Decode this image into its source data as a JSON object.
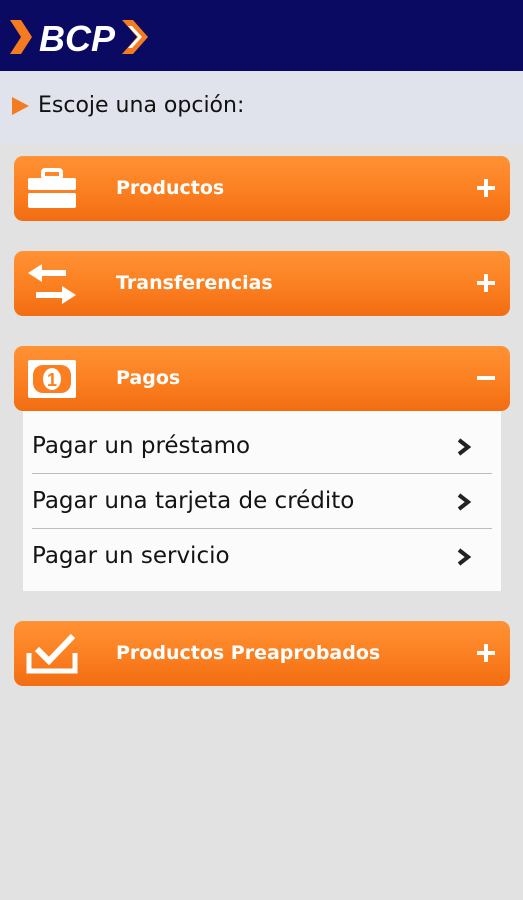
{
  "header": {
    "logo_text": "BCP"
  },
  "prompt": {
    "text": "Escoje una opción:"
  },
  "sections": [
    {
      "label": "Productos",
      "toggle": "plus",
      "icon": "briefcase-icon"
    },
    {
      "label": "Transferencias",
      "toggle": "plus",
      "icon": "transfer-arrows-icon"
    },
    {
      "label": "Pagos",
      "toggle": "minus",
      "icon": "banknote-icon"
    },
    {
      "label": "Productos Preaprobados",
      "toggle": "plus",
      "icon": "checkmark-tray-icon"
    }
  ],
  "pagos_items": [
    {
      "label": "Pagar un préstamo"
    },
    {
      "label": "Pagar una tarjeta de crédito"
    },
    {
      "label": "Pagar un servicio"
    }
  ],
  "colors": {
    "header_bg": "#0a0a63",
    "accent_orange": "#fb7f20",
    "prompt_bg": "#e1e3ec",
    "page_bg": "#e2e2e2"
  }
}
